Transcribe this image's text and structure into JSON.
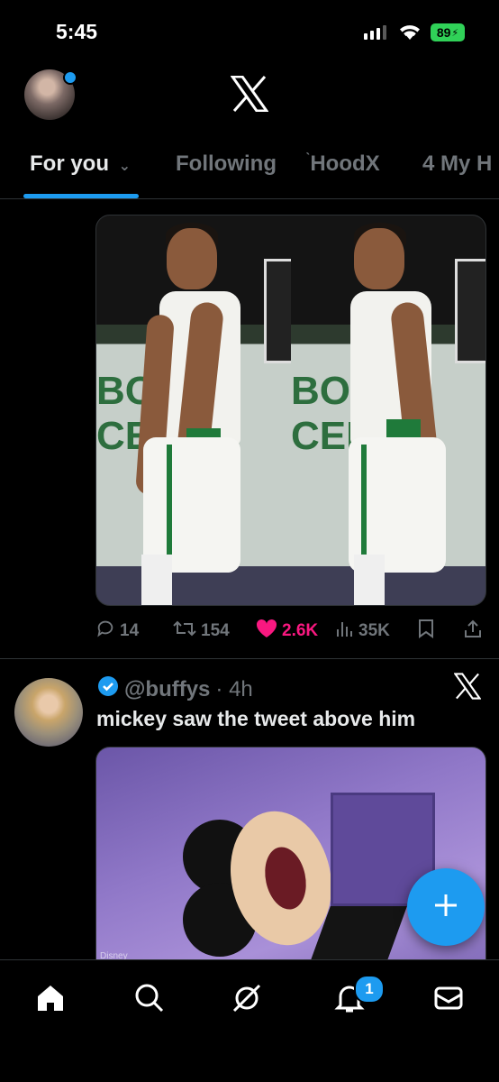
{
  "status_bar": {
    "time": "5:45",
    "battery": "89"
  },
  "header": {
    "logo": "x-logo-icon",
    "avatar": "profile-avatar"
  },
  "tabs": [
    {
      "label": "For you",
      "active": true
    },
    {
      "label": "Following",
      "active": false
    },
    {
      "label": "HoodX",
      "active": false
    },
    {
      "label": "4 My H",
      "active": false
    }
  ],
  "tweet1": {
    "stats": {
      "replies": "14",
      "reposts": "154",
      "likes": "2.6K",
      "views": "35K"
    },
    "media": {
      "letters_left": "BOS\nCEL",
      "letters_right": "BOS\nCEL"
    }
  },
  "tweet2": {
    "handle": "@buffys",
    "time": "· 4h",
    "text": "mickey saw the tweet above him",
    "media_watermark": "Disney"
  },
  "nav": {
    "notifications_badge": "1"
  },
  "colors": {
    "accent": "#1d9bf0",
    "like": "#f91880",
    "muted": "#71767b",
    "battery": "#30d158"
  }
}
